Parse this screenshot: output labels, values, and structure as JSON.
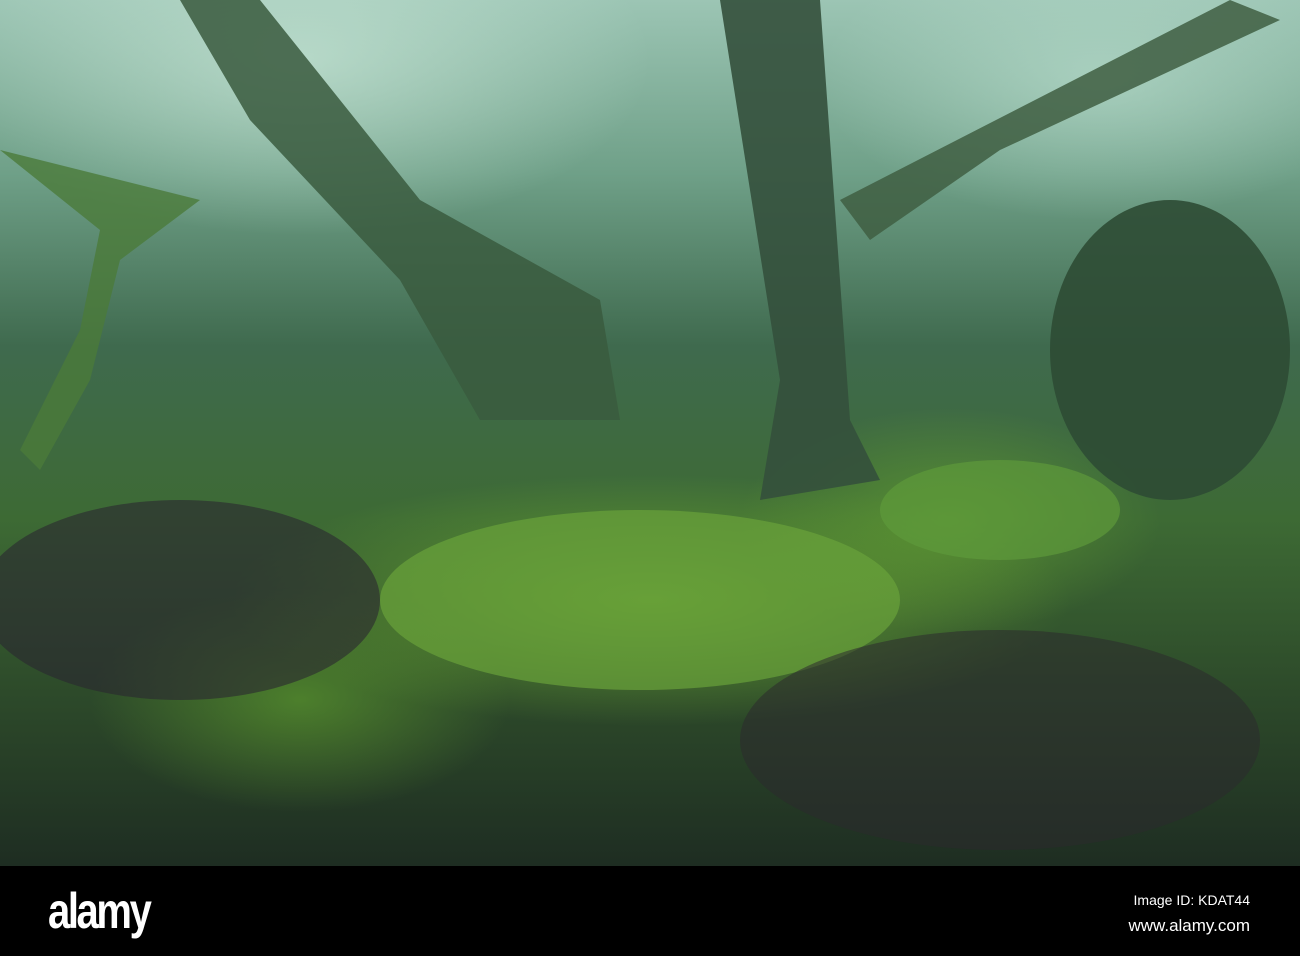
{
  "photo": {
    "subject": "mossy-forest"
  },
  "watermark": {
    "brand": "alamy",
    "image_id": "Image ID: KDAT44",
    "url": "www.alamy.com"
  }
}
